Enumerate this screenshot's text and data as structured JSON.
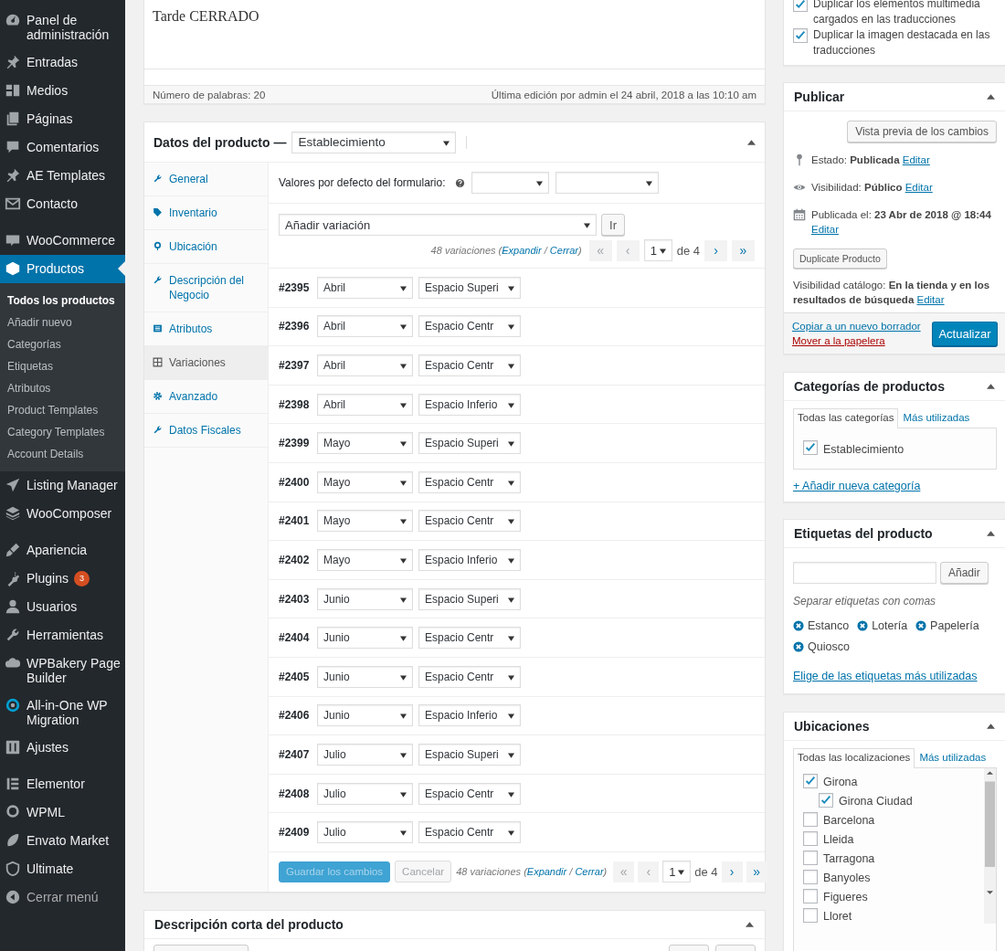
{
  "sidebar": {
    "groups": [
      {
        "items": [
          {
            "label": "Panel de administración",
            "selected": false
          },
          {
            "label": "Entradas",
            "selected": false
          },
          {
            "label": "Medios",
            "selected": false
          },
          {
            "label": "Páginas",
            "selected": false
          },
          {
            "label": "Comentarios",
            "selected": false
          },
          {
            "label": "AE Templates",
            "selected": false
          },
          {
            "label": "Contacto",
            "selected": false
          }
        ]
      },
      {
        "items": [
          {
            "label": "WooCommerce",
            "selected": false
          },
          {
            "label": "Productos",
            "selected": true,
            "children": [
              {
                "label": "Todos los productos",
                "selected": true
              },
              {
                "label": "Añadir nuevo",
                "selected": false
              },
              {
                "label": "Categorías",
                "selected": false
              },
              {
                "label": "Etiquetas",
                "selected": false
              },
              {
                "label": "Atributos",
                "selected": false
              },
              {
                "label": "Product Templates",
                "selected": false
              },
              {
                "label": "Category Templates",
                "selected": false
              },
              {
                "label": "Account Details",
                "selected": false
              }
            ]
          },
          {
            "label": "Listing Manager",
            "selected": false
          },
          {
            "label": "WooComposer",
            "selected": false
          }
        ]
      },
      {
        "items": [
          {
            "label": "Apariencia",
            "selected": false
          },
          {
            "label": "Plugins",
            "selected": false,
            "badge": "3"
          },
          {
            "label": "Usuarios",
            "selected": false
          },
          {
            "label": "Herramientas",
            "selected": false
          },
          {
            "label": "WPBakery Page Builder",
            "selected": false
          },
          {
            "label": "All-in-One WP Migration",
            "selected": false
          },
          {
            "label": "Ajustes",
            "selected": false
          }
        ]
      },
      {
        "items": [
          {
            "label": "Elementor",
            "selected": false
          },
          {
            "label": "WPML",
            "selected": false
          },
          {
            "label": "Envato Market",
            "selected": false
          },
          {
            "label": "Ultimate",
            "selected": false
          }
        ]
      }
    ],
    "collapse_label": "Cerrar menú"
  },
  "editor": {
    "content": "Tarde CERRADO",
    "word_count": "Número de palabras: 20",
    "last_edit": "Última edición por admin el 24 abril, 2018 a las 10:10 am"
  },
  "product_data": {
    "title": "Datos del producto —",
    "type_select": "Establecimiento",
    "tabs": [
      {
        "label": "General",
        "selected": false
      },
      {
        "label": "Inventario",
        "selected": false
      },
      {
        "label": "Ubicación",
        "selected": false
      },
      {
        "label": "Descripción del Negocio",
        "selected": false
      },
      {
        "label": "Atributos",
        "selected": false
      },
      {
        "label": "Variaciones",
        "selected": true
      },
      {
        "label": "Avanzado",
        "selected": false
      },
      {
        "label": "Datos Fiscales",
        "selected": false
      }
    ],
    "defaults_label": "Valores por defecto del formulario:",
    "bulk_action": "Añadir variación",
    "go_button": "Ir",
    "pagination_top": {
      "count": "48 variaciones (",
      "expand": "Expandir",
      "sep": " / ",
      "collapse": "Cerrar",
      "close_paren": ")",
      "prev": [
        {
          "label": "«",
          "disabled": true
        },
        {
          "label": "‹",
          "disabled": true
        }
      ],
      "page": "1",
      "total": "de 4",
      "next": [
        {
          "label": "›",
          "disabled": false
        },
        {
          "label": "»",
          "disabled": false
        }
      ]
    },
    "variations": [
      {
        "id": "#2395",
        "month": "Abril",
        "space": "Espacio Superi"
      },
      {
        "id": "#2396",
        "month": "Abril",
        "space": "Espacio Centr"
      },
      {
        "id": "#2397",
        "month": "Abril",
        "space": "Espacio Centr"
      },
      {
        "id": "#2398",
        "month": "Abril",
        "space": "Espacio Inferio"
      },
      {
        "id": "#2399",
        "month": "Mayo",
        "space": "Espacio Superi"
      },
      {
        "id": "#2400",
        "month": "Mayo",
        "space": "Espacio Centr"
      },
      {
        "id": "#2401",
        "month": "Mayo",
        "space": "Espacio Centr"
      },
      {
        "id": "#2402",
        "month": "Mayo",
        "space": "Espacio Inferio"
      },
      {
        "id": "#2403",
        "month": "Junio",
        "space": "Espacio Superi"
      },
      {
        "id": "#2404",
        "month": "Junio",
        "space": "Espacio Centr"
      },
      {
        "id": "#2405",
        "month": "Junio",
        "space": "Espacio Centr"
      },
      {
        "id": "#2406",
        "month": "Junio",
        "space": "Espacio Inferio"
      },
      {
        "id": "#2407",
        "month": "Julio",
        "space": "Espacio Superi"
      },
      {
        "id": "#2408",
        "month": "Julio",
        "space": "Espacio Centr"
      },
      {
        "id": "#2409",
        "month": "Julio",
        "space": "Espacio Centr"
      }
    ],
    "save_button": {
      "label": "Guardar los cambios",
      "disabled": true
    },
    "cancel_button": {
      "label": "Cancelar",
      "disabled": true
    },
    "pagination_bottom": {
      "count": "48 variaciones (",
      "expand": "Expandir",
      "sep": " / ",
      "collapse": "Cerrar",
      "close_paren": ")",
      "prev": [
        {
          "label": "«",
          "disabled": true
        },
        {
          "label": "‹",
          "disabled": true
        }
      ],
      "page": "1",
      "total": "de 4",
      "next": [
        {
          "label": "›",
          "disabled": false
        },
        {
          "label": "»",
          "disabled": false
        }
      ]
    }
  },
  "short_description": {
    "title": "Descripción corta del producto"
  },
  "translation_options": [
    {
      "label": "Duplicar los elementos multimedia cargados en las traducciones",
      "checked": true
    },
    {
      "label": "Duplicar la imagen destacada en las traducciones",
      "checked": true
    }
  ],
  "publish": {
    "title": "Publicar",
    "preview_button": "Vista previa de los cambios",
    "meta": [
      {
        "label": "Estado:",
        "value": "Publicada",
        "link": "Editar"
      },
      {
        "label": "Visibilidad:",
        "value": "Público",
        "link": "Editar"
      },
      {
        "label": "Publicada el:",
        "value": "23 Abr de 2018 @ 18:44",
        "link": "Editar"
      }
    ],
    "duplicate_button": "Duplicate Producto",
    "catalog": {
      "label": "Visibilidad catálogo:",
      "value": "En la tienda y en los resultados de búsqueda",
      "link": "Editar"
    },
    "copy_link": "Copiar a un nuevo borrador",
    "trash_link": "Mover a la papelera",
    "update_button": "Actualizar"
  },
  "categories": {
    "title": "Categorías de productos",
    "tabs": [
      {
        "label": "Todas las categorías",
        "selected": true
      },
      {
        "label": "Más utilizadas",
        "selected": false
      }
    ],
    "items": [
      {
        "label": "Establecimiento",
        "checked": true
      }
    ],
    "add_link": "+ Añadir nueva categoría"
  },
  "tags": {
    "title": "Etiquetas del producto",
    "add_button": "Añadir",
    "hint": "Separar etiquetas con comas",
    "items": [
      {
        "label": "Estanco"
      },
      {
        "label": "Lotería"
      },
      {
        "label": "Papelería"
      },
      {
        "label": "Quiosco"
      }
    ],
    "choose_link": "Elige de las etiquetas más utilizadas"
  },
  "locations": {
    "title": "Ubicaciones",
    "tabs": [
      {
        "label": "Todas las localizaciones",
        "selected": true
      },
      {
        "label": "Más utilizadas",
        "selected": false
      }
    ],
    "items": [
      {
        "label": "Girona",
        "checked": true,
        "children": [
          {
            "label": "Girona Ciudad",
            "checked": true
          }
        ]
      },
      {
        "label": "Barcelona",
        "checked": false
      },
      {
        "label": "Lleida",
        "checked": false
      },
      {
        "label": "Tarragona",
        "checked": false
      },
      {
        "label": "Banyoles",
        "checked": false
      },
      {
        "label": "Figueres",
        "checked": false
      },
      {
        "label": "Lloret",
        "checked": false
      }
    ]
  }
}
